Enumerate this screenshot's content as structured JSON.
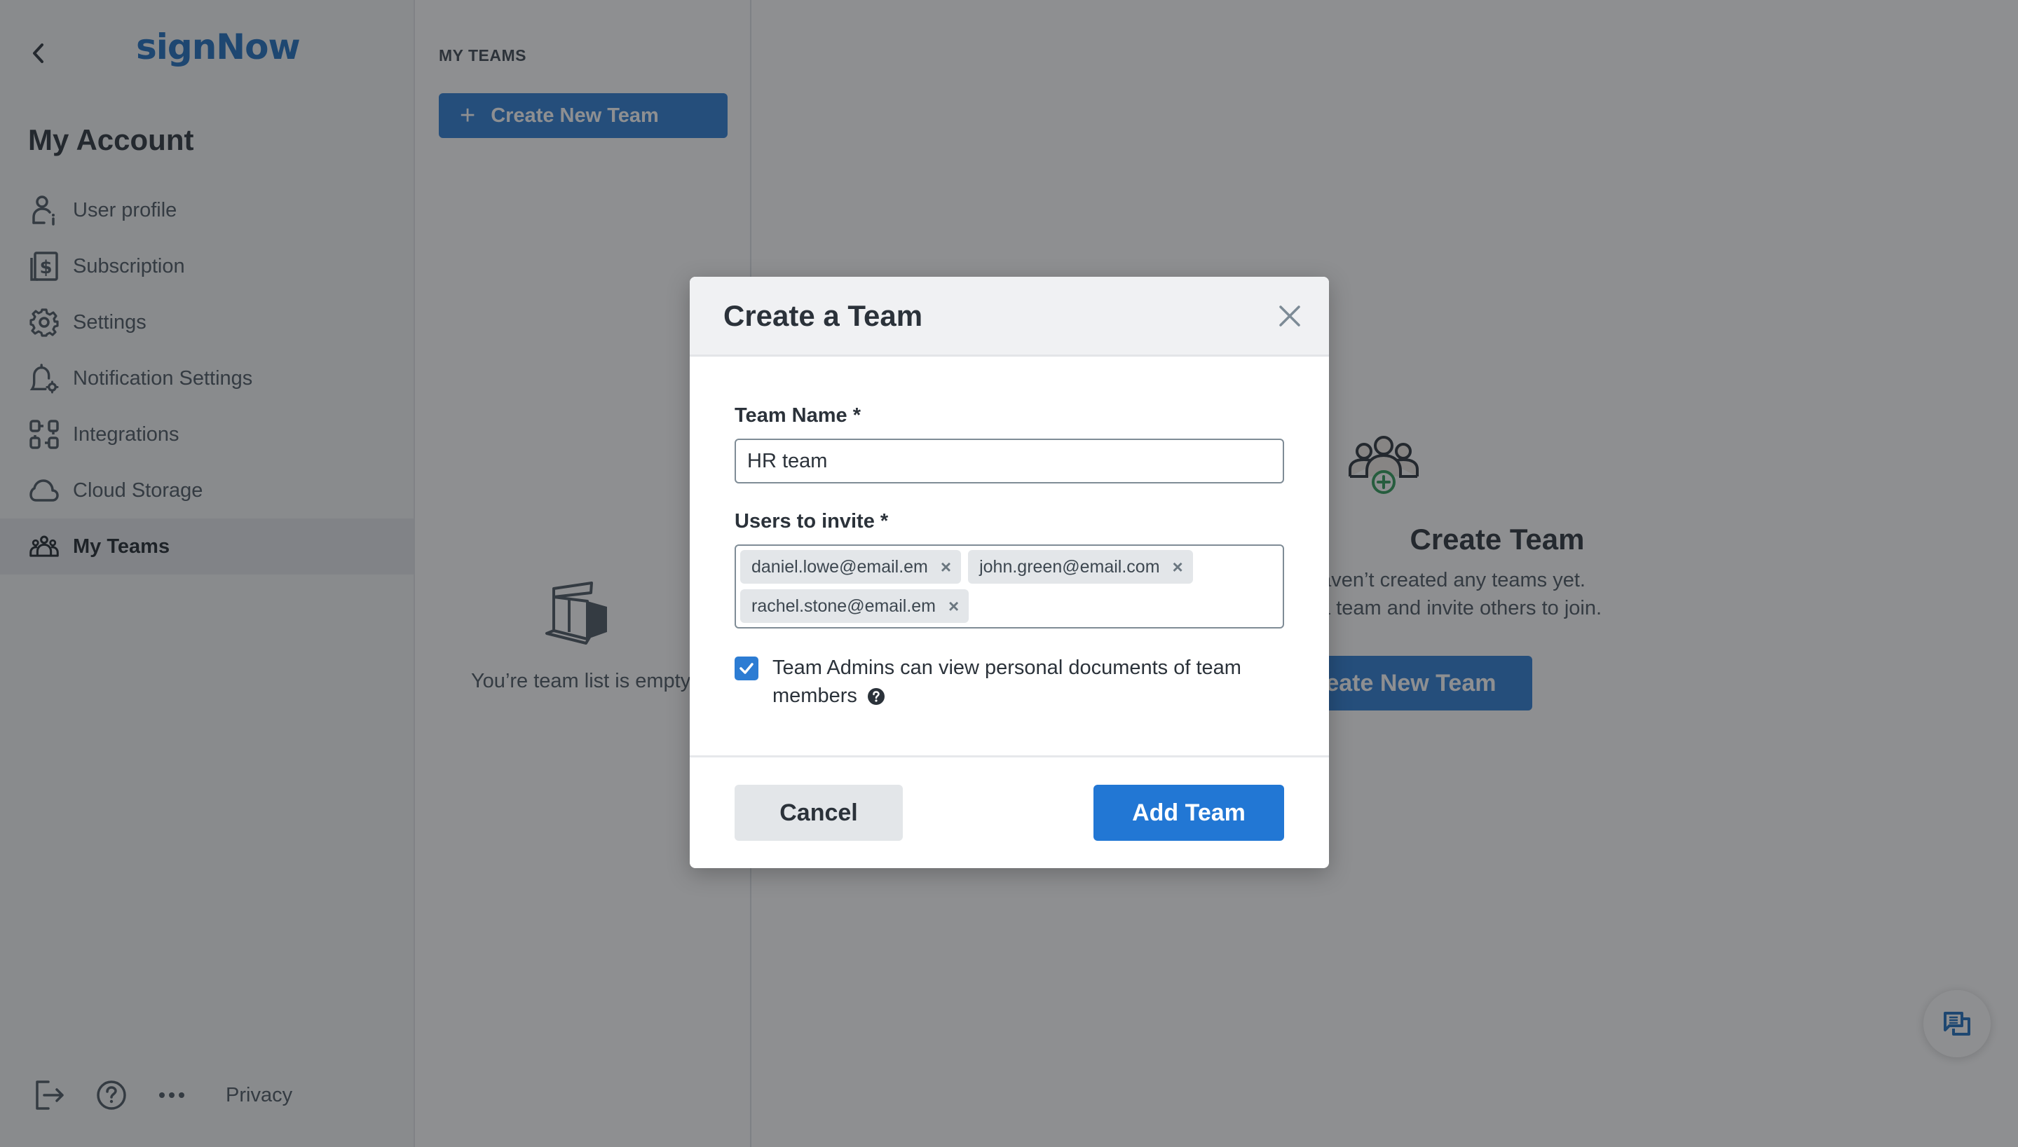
{
  "sidebar": {
    "logo": "signNow",
    "title": "My Account",
    "items": [
      {
        "label": "User profile",
        "icon": "user-info-icon",
        "active": false
      },
      {
        "label": "Subscription",
        "icon": "subscription-dollar-icon",
        "active": false
      },
      {
        "label": "Settings",
        "icon": "gear-icon",
        "active": false
      },
      {
        "label": "Notification Settings",
        "icon": "bell-gear-icon",
        "active": false
      },
      {
        "label": "Integrations",
        "icon": "integrations-icon",
        "active": false
      },
      {
        "label": "Cloud Storage",
        "icon": "cloud-icon",
        "active": false
      },
      {
        "label": "My Teams",
        "icon": "team-icon",
        "active": true
      }
    ],
    "footer": {
      "privacy_label": "Privacy"
    }
  },
  "teams_panel": {
    "heading": "MY TEAMS",
    "create_button": "Create New Team",
    "empty_text": "You’re team list is empty"
  },
  "content": {
    "heading": "Create Team",
    "subtext_line1": "You haven’t created any teams yet.",
    "subtext_line2": "Create a team and invite others to join.",
    "create_button": "Create New Team"
  },
  "modal": {
    "title": "Create a Team",
    "team_name_label": "Team Name *",
    "team_name_value": "HR team",
    "users_label": "Users to invite *",
    "invitees": [
      "daniel.lowe@email.em",
      "john.green@email.com",
      "rachel.stone@email.em"
    ],
    "remove_glyph": "×",
    "checkbox_checked": true,
    "checkbox_label": "Team Admins can view personal documents of team members",
    "cancel_label": "Cancel",
    "submit_label": "Add Team"
  },
  "colors": {
    "brand": "#1f6fbf",
    "primary_button": "#2277d4",
    "add_icon_green": "#2e9a58"
  }
}
